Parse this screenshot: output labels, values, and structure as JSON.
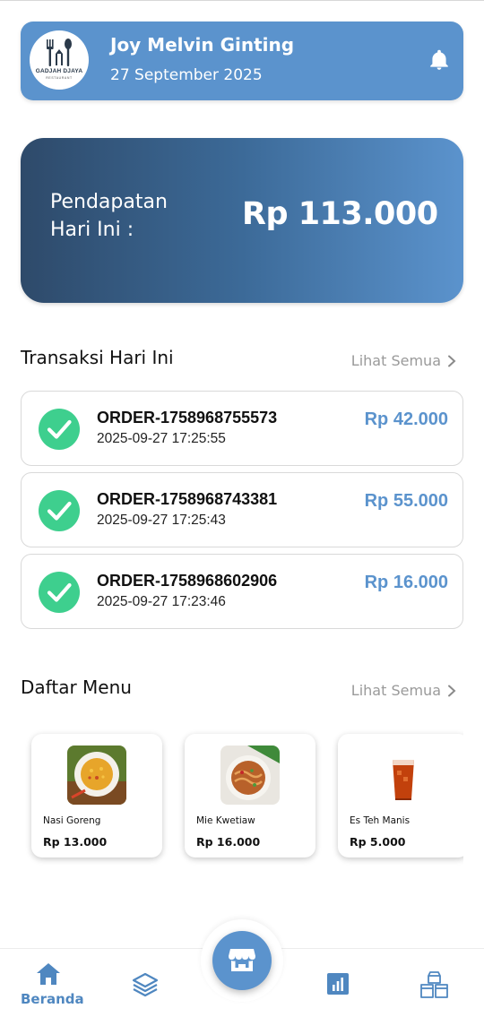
{
  "header": {
    "logo_text": "GADJAH DJAYA",
    "logo_subtext": "RESTAURANT",
    "user_name": "Joy Melvin Ginting",
    "date": "27 September 2025",
    "notification_icon": "bell-icon"
  },
  "revenue": {
    "label": "Pendapatan Hari Ini :",
    "amount": "Rp 113.000"
  },
  "transactions": {
    "title": "Transaksi Hari Ini",
    "see_all": "Lihat Semua",
    "items": [
      {
        "id": "ORDER-1758968755573",
        "time": "2025-09-27 17:25:55",
        "amount": "Rp 42.000",
        "status_icon": "check-circle-icon"
      },
      {
        "id": "ORDER-1758968743381",
        "time": "2025-09-27 17:25:43",
        "amount": "Rp 55.000",
        "status_icon": "check-circle-icon"
      },
      {
        "id": "ORDER-1758968602906",
        "time": "2025-09-27 17:23:46",
        "amount": "Rp 16.000",
        "status_icon": "check-circle-icon"
      }
    ]
  },
  "menu": {
    "title": "Daftar Menu",
    "see_all": "Lihat Semua",
    "items": [
      {
        "name": "Nasi Goreng",
        "price": "Rp 13.000"
      },
      {
        "name": "Mie Kwetiaw",
        "price": "Rp 16.000"
      },
      {
        "name": "Es Teh Manis",
        "price": "Rp 5.000"
      }
    ]
  },
  "nav": {
    "home_label": "Beranda",
    "icons": [
      "home-icon",
      "layers-icon",
      "store-icon",
      "bar-chart-icon",
      "boxes-icon"
    ]
  },
  "colors": {
    "primary": "#5b93cd",
    "dark_gradient": "#2e4a6a",
    "success": "#3ecf8e"
  }
}
